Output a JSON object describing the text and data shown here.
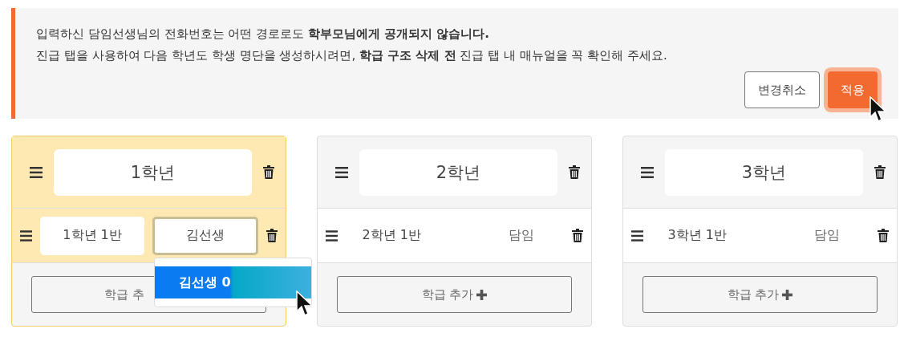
{
  "notice": {
    "lines": [
      "입력하신 담임선생님의 전화번호는 어떤 경로로도 **학부모님에게 공개되지 않습니다.**",
      "진급 탭을 사용하여 다음 학년도 학생 명단을 생성하시려면, **학급 구조 삭제 전** 진급 탭 내 매뉴얼을 꼭 확인해 주세요."
    ]
  },
  "buttons": [
    {
      "label": "변경취소",
      "kind": "outline"
    },
    {
      "label": "적용",
      "kind": "primary"
    }
  ],
  "grades": [
    {
      "name": "1학년",
      "editing": true,
      "classes": [
        {
          "name": "1학년 1반",
          "teacher": "김선생",
          "editing": true
        }
      ],
      "add_button": {
        "label": "학급 추",
        "plus": false
      },
      "suggestions": [
        {
          "label": "김선생 0",
          "selected": true
        }
      ]
    },
    {
      "name": "2학년",
      "editing": false,
      "classes": [
        {
          "name": "2학년 1반",
          "teacher": "담임",
          "editing": false
        }
      ],
      "add_button": {
        "label": "학급 추가",
        "plus": true
      }
    },
    {
      "name": "3학년",
      "editing": false,
      "classes": [
        {
          "name": "3학년 1반",
          "teacher": "담임",
          "editing": false
        }
      ],
      "add_button": {
        "label": "학급 추가",
        "plus": true
      }
    }
  ]
}
